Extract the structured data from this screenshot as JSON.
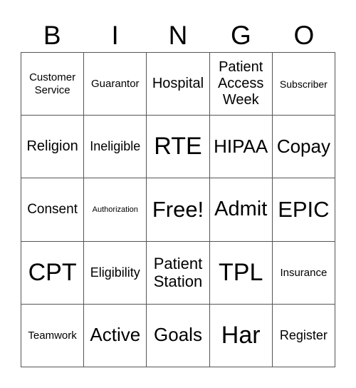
{
  "header": [
    "B",
    "I",
    "N",
    "G",
    "O"
  ],
  "cells": [
    {
      "text": "Customer Service",
      "size": 15
    },
    {
      "text": "Guarantor",
      "size": 15
    },
    {
      "text": "Hospital",
      "size": 20
    },
    {
      "text": "Patient Access Week",
      "size": 20
    },
    {
      "text": "Subscriber",
      "size": 14
    },
    {
      "text": "Religion",
      "size": 20
    },
    {
      "text": "Ineligible",
      "size": 18
    },
    {
      "text": "RTE",
      "size": 34
    },
    {
      "text": "HIPAA",
      "size": 26
    },
    {
      "text": "Copay",
      "size": 26
    },
    {
      "text": "Consent",
      "size": 19
    },
    {
      "text": "Authorization",
      "size": 11
    },
    {
      "text": "Free!",
      "size": 31
    },
    {
      "text": "Admit",
      "size": 29
    },
    {
      "text": "EPIC",
      "size": 31
    },
    {
      "text": "CPT",
      "size": 34
    },
    {
      "text": "Eligibility",
      "size": 18
    },
    {
      "text": "Patient Station",
      "size": 22
    },
    {
      "text": "TPL",
      "size": 34
    },
    {
      "text": "Insurance",
      "size": 15
    },
    {
      "text": "Teamwork",
      "size": 15
    },
    {
      "text": "Active",
      "size": 26
    },
    {
      "text": "Goals",
      "size": 26
    },
    {
      "text": "Har",
      "size": 34
    },
    {
      "text": "Register",
      "size": 18
    }
  ]
}
